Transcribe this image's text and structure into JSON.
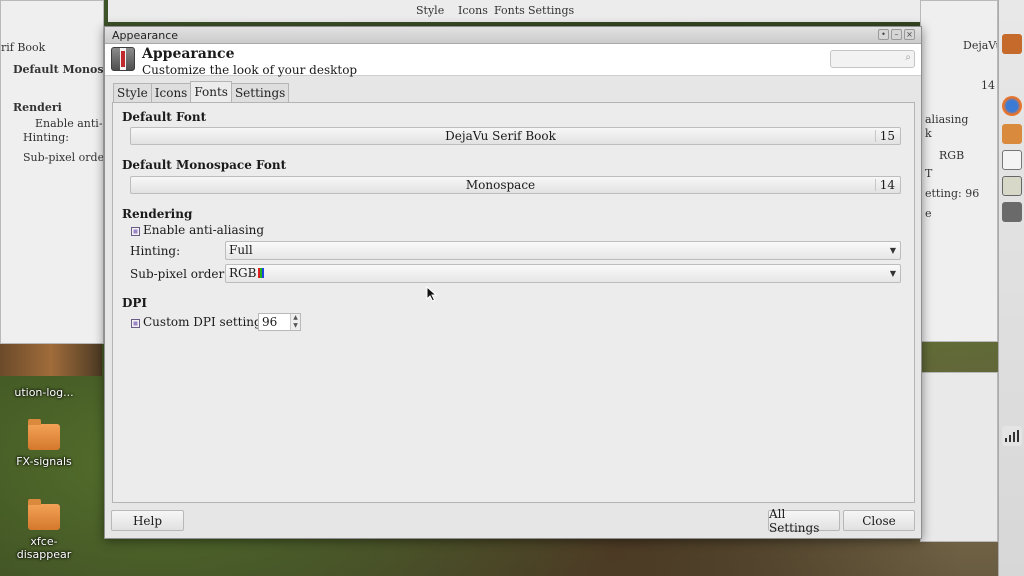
{
  "background": {
    "left_top_items": [
      "rif Book",
      "Default Monos",
      "Renderi",
      "Enable anti-a",
      "Hinting:",
      "Sub-pixel order"
    ],
    "right_items": [
      "DejaVu",
      "14",
      "aliasing",
      "k",
      "RGB",
      "T",
      "etting: 96",
      "e"
    ],
    "top_tabs": [
      "Style",
      "Icons",
      "Fonts",
      "Settings"
    ],
    "desktop_icons": [
      {
        "label": "ution-log..."
      },
      {
        "label": "FX-signals"
      },
      {
        "label": "xfce-disappear"
      }
    ]
  },
  "window": {
    "title": "Appearance",
    "header_title": "Appearance",
    "header_subtitle": "Customize the look of your desktop",
    "search_placeholder": "",
    "tabs": [
      {
        "label": "Style"
      },
      {
        "label": "Icons"
      },
      {
        "label": "Fonts",
        "active": true
      },
      {
        "label": "Settings"
      }
    ],
    "fonts": {
      "default_font_heading": "Default Font",
      "default_font_name": "DejaVu Serif Book",
      "default_font_size": "15",
      "mono_heading": "Default Monospace Font",
      "mono_font_name": "Monospace",
      "mono_font_size": "14"
    },
    "rendering": {
      "heading": "Rendering",
      "antialias_label": "Enable anti-aliasing",
      "antialias_checked": true,
      "hinting_label": "Hinting:",
      "hinting_value": "Full",
      "subpixel_label": "Sub-pixel order:",
      "subpixel_value": "RGB"
    },
    "dpi": {
      "heading": "DPI",
      "custom_label": "Custom DPI setting:",
      "custom_checked": true,
      "value": "96"
    },
    "buttons": {
      "help": "Help",
      "all_settings": "All Settings",
      "close": "Close"
    }
  },
  "colors": {
    "checkbox": "#9b84c8",
    "window_bg": "#e6e6e6"
  }
}
